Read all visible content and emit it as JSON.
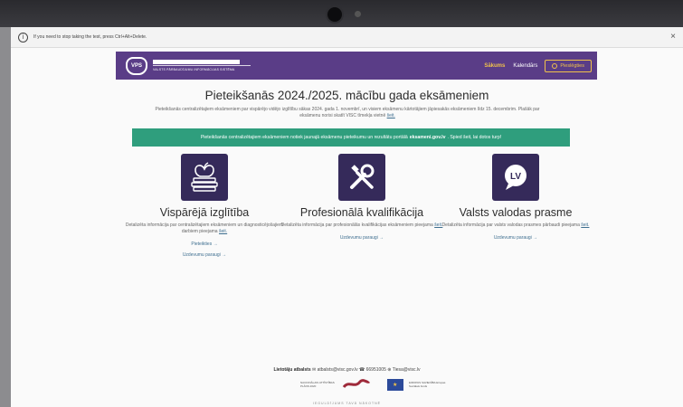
{
  "kiosk": {
    "message": "If you need to stop taking the test, press Ctrl+Alt+Delete.",
    "info_glyph": "i",
    "close_glyph": "×"
  },
  "nav": {
    "logo_badge": "VPS",
    "logo_subtitle": "VALSTS PĀRBAUDĪJUMU INFORMĀCIJAS SISTĒMA",
    "home": "Sākums",
    "calendar": "Kalendārs",
    "login": "Pieslēgties"
  },
  "title": "Pieteikšanās 2024./2025. mācību gada eksāmeniem",
  "intro": {
    "text": "Pieteikšanās centralizētajiem eksāmeniem par vispārējo vidējo izglītību sākas 2024. gada 1. novembrī, un visiem eksāmenu kārtotājiem jāpiesakās eksāmeniem līdz 15. decembrim. Plašāk par eksāmenu norisi skatīt VISC tīmekļa vietnē",
    "link": "šeit."
  },
  "banner": {
    "before": "Pieteikšanās centralizētajiem eksāmeniem notiek jaunajā eksāmenu pieteikumu un rezultātu portālā",
    "link": "eksameni.gov.lv",
    "after": ". Spied šeit, lai dotos turp!"
  },
  "columns": [
    {
      "icon": "book-apple-icon",
      "title": "Vispārējā izglītība",
      "desc": "Detalizēta informācija par centralizētajiem eksāmeniem un diagnosticējošajiem darbiem pieejama",
      "desc_link": "šeit.",
      "link1": "Pieteikties →",
      "link2": "Uzdevumu paraugi →"
    },
    {
      "icon": "tools-icon",
      "title": "Profesionālā kvalifikācija",
      "desc": "Detalizēta informācija par profesionālās kvalifikācijas eksāmeniem pieejama",
      "desc_link": "šeit.",
      "link1": "Uzdevumu paraugi →"
    },
    {
      "icon": "lv-speech-bubble-icon",
      "icon_text": "LV",
      "title": "Valsts valodas prasme",
      "desc": "Detalizēta informācija par valsts valodas prasmes pārbaudi pieejama",
      "desc_link": "šeit.",
      "link1": "Uzdevumu paraugi →"
    }
  ],
  "footer": {
    "label": "Lietotāju atbalsts",
    "email": "atbalsts@visc.gov.lv",
    "phone": "66951005",
    "web": "Tiesa@visc.lv"
  },
  "sponsors": {
    "nap": "NACIONĀLAIS ATTĪSTĪBAS PLĀNS 2020",
    "esf": "EIROPAS SAVIENĪBA Eiropas Sociālais fonds",
    "invest": "IEGULDĪJUMS TAVĀ NĀKOTNĒ"
  },
  "colors": {
    "nav": "#5a3d87",
    "accent": "#f0c24b",
    "banner": "#2f9e7d",
    "icon_bg": "#352a5a"
  }
}
